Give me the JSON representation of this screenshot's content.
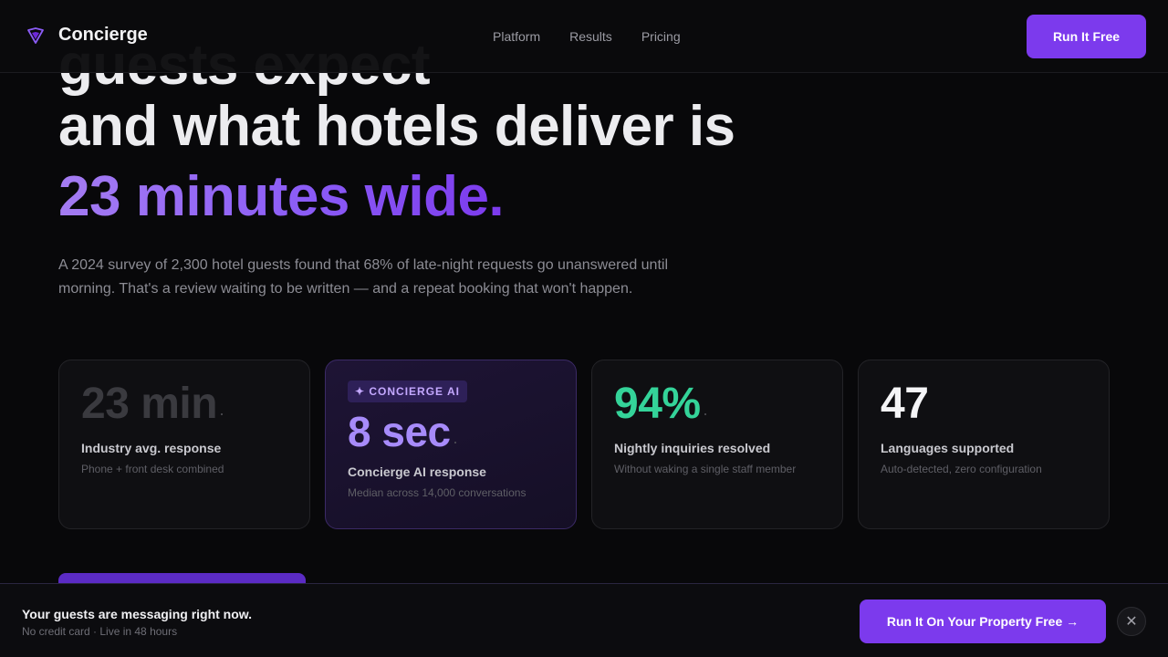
{
  "nav": {
    "brand": "Concierge",
    "links": [
      "Platform",
      "Results",
      "Pricing"
    ],
    "cta": "Run It Free"
  },
  "hero": {
    "line1": "guests expect",
    "line2": "and what hotels deliver is",
    "line3": "23 minutes wide.",
    "subcopy": "A 2024 survey of 2,300 hotel guests found that 68% of late-night requests go unanswered until morning. That's a review waiting to be written — and a repeat booking that won't happen."
  },
  "cards": [
    {
      "stat": "23 min",
      "title": "Industry avg. response",
      "desc": "Phone + front desk combined",
      "color": "#3a3a3f"
    },
    {
      "badge": "✦ CONCIERGE AI",
      "stat": "8 sec",
      "title": "Concierge AI response",
      "desc": "Median across 14,000 conversations",
      "color": "#a78bfa"
    },
    {
      "stat": "94%",
      "title": "Nightly inquiries resolved",
      "desc": "Without waking a single staff member",
      "color": "#34d399"
    },
    {
      "stat": "47",
      "title": "Languages supported",
      "desc": "Auto-detected, zero configuration",
      "color": "#f5f5f7"
    }
  ],
  "sticky": {
    "title": "Your guests are messaging right now.",
    "sub": "No credit card · Live in 48 hours",
    "cta": "Run It On Your Property Free →",
    "close": "✕"
  },
  "icons": {
    "logo": "diamond-logo-icon",
    "close": "close-icon"
  },
  "colors": {
    "accent": "#7c3aed",
    "accent_light": "#a78bfa",
    "success": "#34d399",
    "background": "#08080a"
  }
}
